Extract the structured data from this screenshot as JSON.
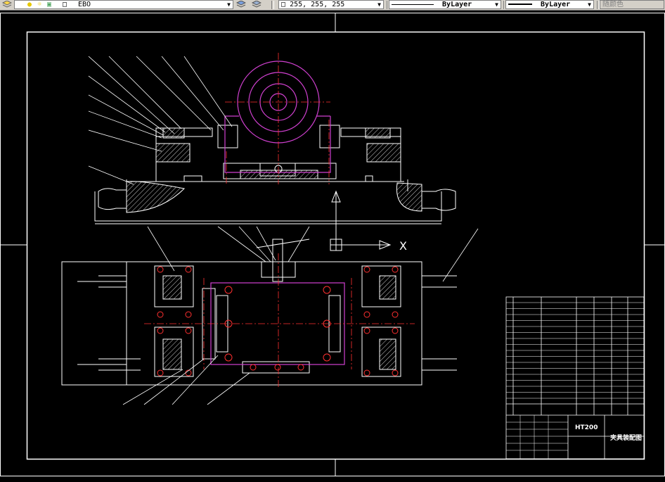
{
  "toolbar": {
    "layer_name": "EBO",
    "color_value": "255, 255, 255",
    "linetype": "ByLayer",
    "lineweight": "ByLayer",
    "plotstyle": "随颜色"
  },
  "drawing": {
    "title_block": {
      "material": "HT200",
      "drawing_name": "夹具装配图"
    }
  },
  "colors": {
    "background": "#000000",
    "frame": "#ffffff",
    "centerline": "#ff3030",
    "part_magenta": "#d040d0",
    "hatch": "#ffffff",
    "leader": "#ffffff"
  },
  "icons": [
    "layers-icon",
    "lightbulb-icon",
    "sun-icon",
    "lock-icon",
    "layer-state-icon",
    "layer-previous-icon",
    "color-swatch-icon"
  ]
}
